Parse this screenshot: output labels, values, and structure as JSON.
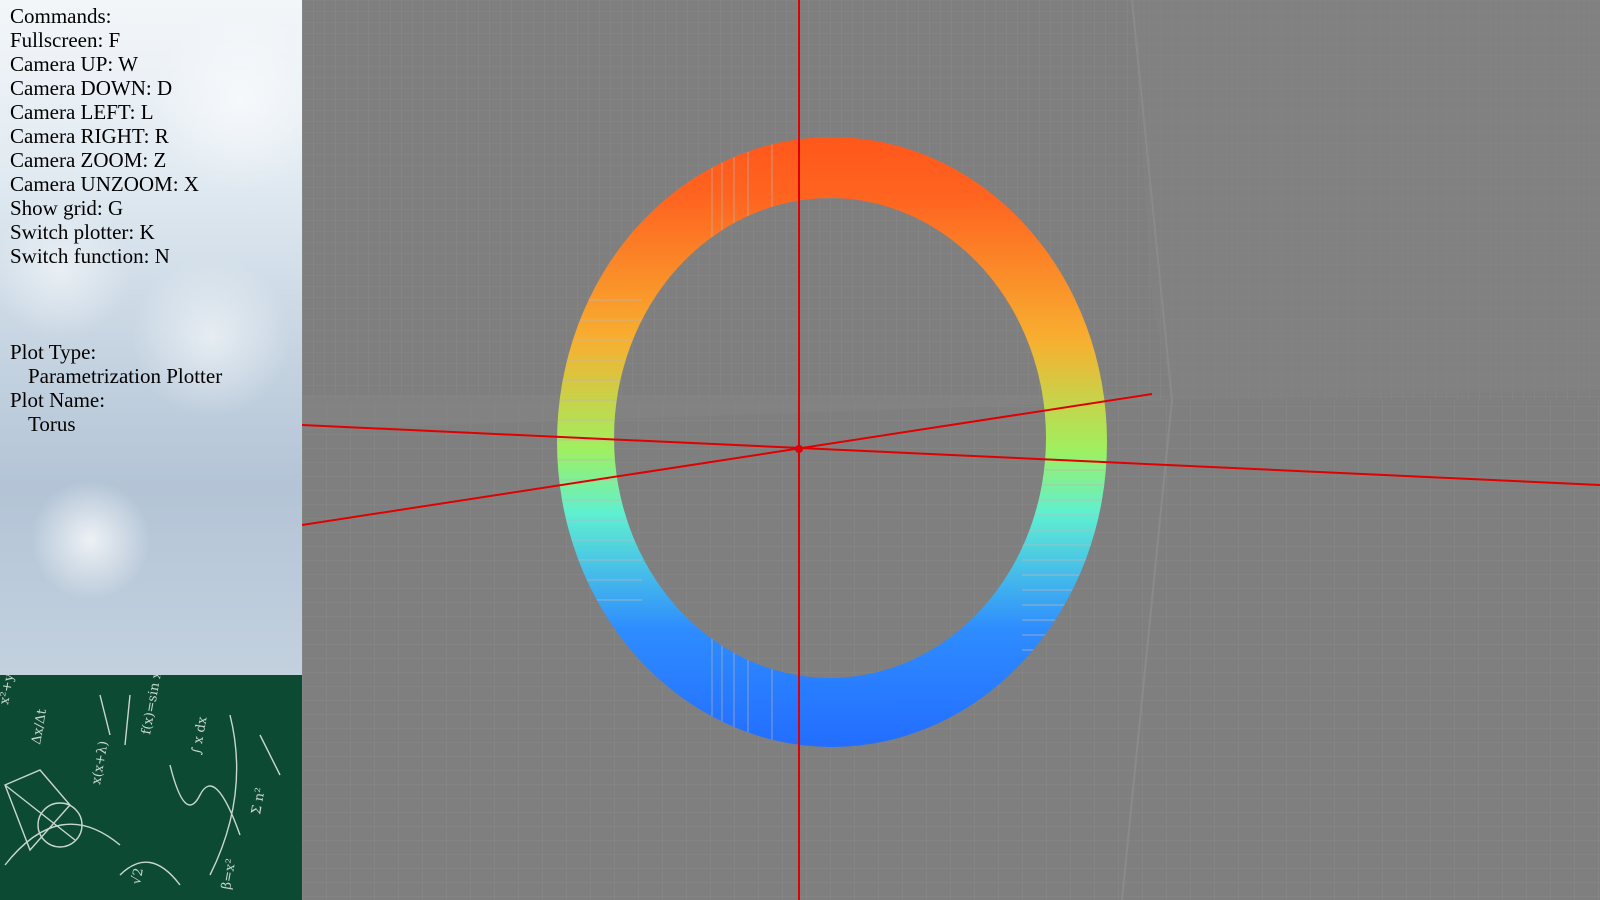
{
  "commands": {
    "title": "Commands:",
    "items": [
      "Fullscreen: F",
      "Camera UP: W",
      "Camera DOWN: D",
      "Camera LEFT: L",
      "Camera RIGHT: R",
      "Camera ZOOM: Z",
      "Camera UNZOOM: X",
      "Show grid: G",
      "Switch plotter: K",
      "Switch function: N"
    ]
  },
  "plot_info": {
    "type_label": "Plot Type:",
    "type_value": "Parametrization Plotter",
    "name_label": "Plot Name:",
    "name_value": "Torus"
  },
  "colors": {
    "background": "#7f7f7f",
    "axis": "#e00000",
    "torus_top": "#ff3a10",
    "torus_mid": "#8ef070",
    "torus_bottom": "#1444ff",
    "chalkboard": "#0d4a33"
  }
}
